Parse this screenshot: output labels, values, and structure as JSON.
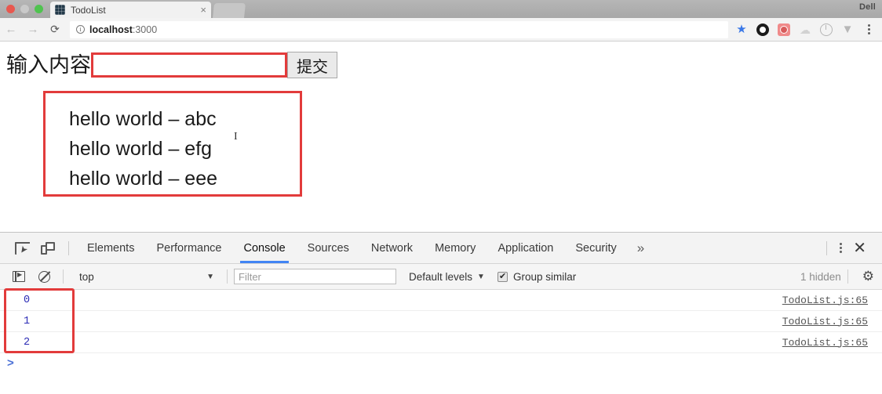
{
  "browser": {
    "tab": {
      "title": "TodoList",
      "close_label": "×",
      "favicon": "todolist-favicon"
    },
    "brand_tag": "Dell",
    "nav": {
      "back": "←",
      "forward": "→",
      "reload": "⟳"
    },
    "address": {
      "info_icon": "ⓘ",
      "host": "localhost",
      "port": ":3000"
    },
    "toolbar_icons": [
      "bookmark-star-icon",
      "extension-donut-icon",
      "extension-red-icon",
      "extension-faded-icon",
      "history-clock-icon",
      "filter-funnel-icon",
      "chrome-menu-icon"
    ]
  },
  "page": {
    "form": {
      "label": "输入内容",
      "input_value": "",
      "input_placeholder": "",
      "submit_label": "提交"
    },
    "todo_items": [
      "hello world – abc",
      "hello world – efg",
      "hello world – eee"
    ],
    "cursor_glyph": "I"
  },
  "devtools": {
    "tabs": [
      {
        "label": "Elements",
        "active": false
      },
      {
        "label": "Performance",
        "active": false
      },
      {
        "label": "Console",
        "active": true
      },
      {
        "label": "Sources",
        "active": false
      },
      {
        "label": "Network",
        "active": false
      },
      {
        "label": "Memory",
        "active": false
      },
      {
        "label": "Application",
        "active": false
      },
      {
        "label": "Security",
        "active": false
      }
    ],
    "more_tabs": "»",
    "close_label": "✕",
    "filterbar": {
      "context": "top",
      "context_caret": "▼",
      "filter_placeholder": "Filter",
      "filter_value": "",
      "levels_label": "Default levels",
      "levels_caret": "▼",
      "group_similar_label": "Group similar",
      "group_similar_checked": true,
      "hidden_count": "1 hidden",
      "gear_icon": "⚙"
    },
    "console_rows": [
      {
        "message": "0",
        "source": "TodoList.js:65"
      },
      {
        "message": "1",
        "source": "TodoList.js:65"
      },
      {
        "message": "2",
        "source": "TodoList.js:65"
      }
    ],
    "prompt": ">"
  },
  "colors": {
    "annotation_red": "#e23b3b",
    "active_tab_blue": "#4285f4",
    "log_text_blue": "#2b2bb5",
    "prompt_blue": "#4a70d6"
  }
}
